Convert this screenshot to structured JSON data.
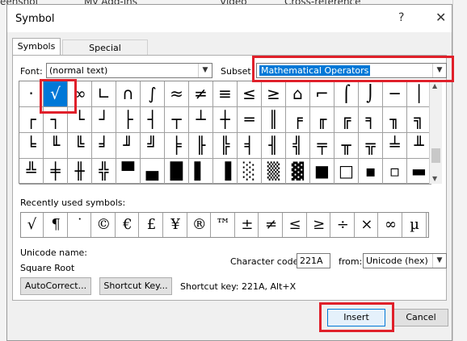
{
  "background": {
    "ribbon_items": [
      "eenshot",
      "My Add-ins",
      "Video",
      "Cross-reference"
    ]
  },
  "dialog": {
    "title": "Symbol",
    "help_glyph": "?",
    "close_glyph": "✕"
  },
  "tabs": [
    {
      "label": "Symbols",
      "active": true
    },
    {
      "label": "Special Characters",
      "active": false
    }
  ],
  "font": {
    "label": "Font:",
    "value": "(normal text)"
  },
  "subset": {
    "label": "Subset:",
    "value": "Mathematical Operators"
  },
  "symbol_grid": {
    "rows": [
      [
        "·",
        "√",
        "∞",
        "∟",
        "∩",
        "∫",
        "≈",
        "≠",
        "≡",
        "≤",
        "≥",
        "⌂",
        "⌐",
        "⌠",
        "⌡",
        "─",
        "│"
      ],
      [
        "┌",
        "┐",
        "└",
        "┘",
        "├",
        "┤",
        "┬",
        "┴",
        "┼",
        "═",
        "║",
        "╒",
        "╓",
        "╔",
        "╕",
        "╖",
        "╗"
      ],
      [
        "╘",
        "╙",
        "╚",
        "╛",
        "╜",
        "╝",
        "╞",
        "╟",
        "╠",
        "╡",
        "╢",
        "╣",
        "╤",
        "╥",
        "╦",
        "╧",
        "╨"
      ],
      [
        "╩",
        "╪",
        "╫",
        "╬",
        "▀",
        "▄",
        "█",
        "▌",
        "▐",
        "░",
        "▒",
        "▓",
        "■",
        "□",
        "▪",
        "▫",
        "▬"
      ]
    ],
    "selected": "√"
  },
  "recent": {
    "label": "Recently used symbols:",
    "symbols": [
      "√",
      "¶",
      "˙",
      "©",
      "€",
      "£",
      "¥",
      "®",
      "™",
      "±",
      "≠",
      "≤",
      "≥",
      "÷",
      "×",
      "∞",
      "µ"
    ]
  },
  "unicode": {
    "label": "Unicode name:",
    "name": "Square Root"
  },
  "char_code": {
    "label": "Character code:",
    "value": "221A"
  },
  "from": {
    "label": "from:",
    "value": "Unicode (hex)"
  },
  "buttons": {
    "autocorrect": "AutoCorrect...",
    "shortcut_key": "Shortcut Key...",
    "insert": "Insert",
    "cancel": "Cancel"
  },
  "shortcut_text": "Shortcut key: 221A, Alt+X",
  "colors": {
    "highlight": "#0078d7",
    "annotation": "#e0202a"
  }
}
